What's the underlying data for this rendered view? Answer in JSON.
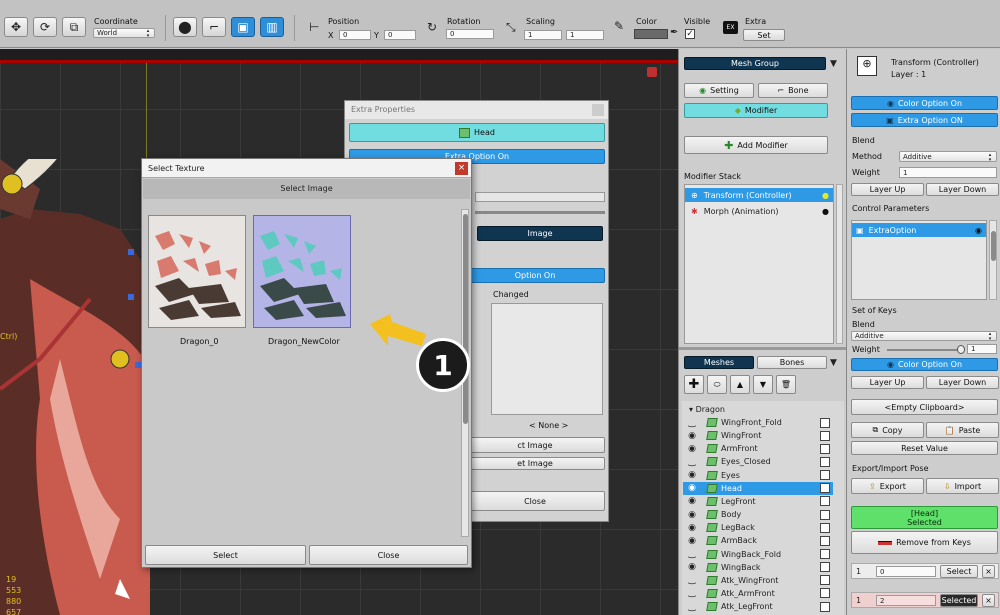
{
  "toolbar": {
    "coordinate_label": "Coordinate",
    "coordinate_value": "World",
    "position_label": "Position",
    "pos_x_label": "X",
    "pos_x": "0",
    "pos_y_label": "Y",
    "pos_y": "0",
    "rotation_label": "Rotation",
    "rotation": "0",
    "scaling_label": "Scaling",
    "scale_x": "1",
    "scale_y": "1",
    "color_label": "Color",
    "visible_label": "Visible",
    "extra_label": "Extra",
    "extra_set": "Set"
  },
  "viewport": {
    "left_label": "Ctrl)",
    "stats": [
      "19",
      "553",
      "880",
      "657"
    ]
  },
  "select_texture": {
    "title": "Select Texture",
    "heading": "Select Image",
    "images": [
      {
        "name": "Dragon_0"
      },
      {
        "name": "Dragon_NewColor"
      }
    ],
    "select_button": "Select",
    "close_button": "Close",
    "callout": "1"
  },
  "extra_properties": {
    "title": "Extra Properties",
    "head_button": "Head",
    "extra_option_on": "Extra Option On",
    "image_button": "Image",
    "option_on": "Option On",
    "changed_label": "Changed",
    "none_label": "< None >",
    "select_image": "ct Image",
    "reset_image": "et Image",
    "close_button": "Close"
  },
  "mid_panel": {
    "mesh_group": "Mesh Group",
    "setting": "Setting",
    "bone": "Bone",
    "modifier": "Modifier",
    "add_modifier": "Add Modifier",
    "modifier_stack_label": "Modifier Stack",
    "modifiers": [
      {
        "name": "Transform (Controller)"
      },
      {
        "name": "Morph (Animation)"
      }
    ],
    "tab_meshes": "Meshes",
    "tab_bones": "Bones",
    "group_name": "Dragon",
    "meshes": [
      {
        "name": "WingFront_Fold",
        "eye": "closed"
      },
      {
        "name": "WingFront",
        "eye": "open"
      },
      {
        "name": "ArmFront",
        "eye": "open"
      },
      {
        "name": "Eyes_Closed",
        "eye": "closed"
      },
      {
        "name": "Eyes",
        "eye": "open"
      },
      {
        "name": "Head",
        "eye": "open",
        "selected": true
      },
      {
        "name": "LegFront",
        "eye": "open"
      },
      {
        "name": "Body",
        "eye": "open"
      },
      {
        "name": "LegBack",
        "eye": "open"
      },
      {
        "name": "ArmBack",
        "eye": "open"
      },
      {
        "name": "WingBack_Fold",
        "eye": "closed"
      },
      {
        "name": "WingBack",
        "eye": "open"
      },
      {
        "name": "Atk_WingFront",
        "eye": "closed"
      },
      {
        "name": "Atk_ArmFront",
        "eye": "closed"
      },
      {
        "name": "Atk_LegFront",
        "eye": "closed"
      }
    ]
  },
  "right_panel": {
    "title": "Transform (Controller)",
    "layer": "Layer : 1",
    "color_option_on": "Color Option On",
    "extra_option_on": "Extra Option ON",
    "blend_label": "Blend",
    "method_label": "Method",
    "method_value": "Additive",
    "weight_label": "Weight",
    "weight_value": "1",
    "layer_up": "Layer Up",
    "layer_down": "Layer Down",
    "control_params_label": "Control Parameters",
    "control_param_item": "ExtraOption",
    "set_of_keys_label": "Set of Keys",
    "blend2_label": "Blend",
    "blend2_value": "Additive",
    "weight2_label": "Weight",
    "weight2_value": "1",
    "color_option_on2": "Color Option On",
    "layer_up2": "Layer Up",
    "layer_down2": "Layer Down",
    "empty_clipboard": "<Empty Clipboard>",
    "copy": "Copy",
    "paste": "Paste",
    "reset_value": "Reset Value",
    "export_import_label": "Export/Import Pose",
    "export": "Export",
    "import": "Import",
    "selected_head": "[Head]",
    "selected_label": "Selected",
    "remove_from_keys": "Remove from Keys",
    "key_rows": [
      {
        "index": "1",
        "value": "0",
        "button": "Select"
      },
      {
        "index": "1",
        "value": "2",
        "button": "Selected"
      }
    ]
  },
  "colors": {
    "accent_cyan": "#72dde0",
    "accent_blue": "#2e9ae6",
    "navy": "#0f3550",
    "select_green": "#5fe06a",
    "viewport_bg": "#2b2b2b"
  }
}
